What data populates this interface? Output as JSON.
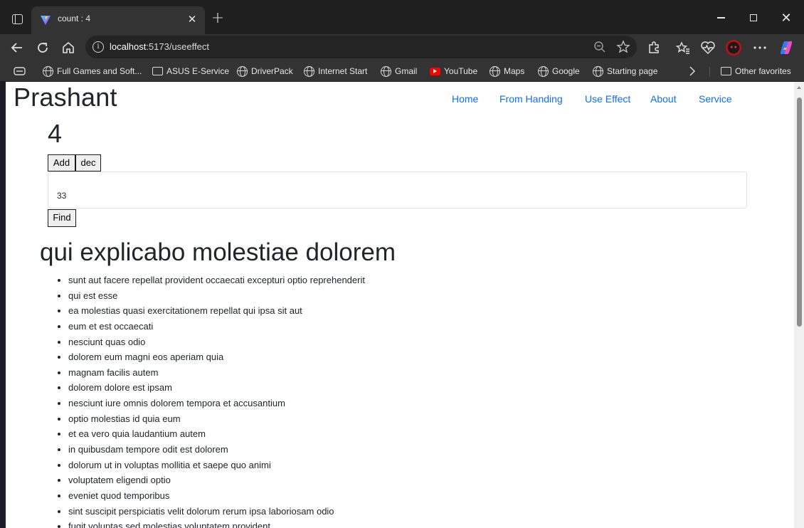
{
  "browser": {
    "tab_title": "count : 4",
    "address": {
      "host": "localhost",
      "path": ":5173/useeffect"
    },
    "bookmarks": [
      {
        "label": "Full Games and Soft...",
        "icon": "globe-icon"
      },
      {
        "label": "ASUS E-Service",
        "icon": "folder-icon"
      },
      {
        "label": "DriverPack",
        "icon": "globe-icon"
      },
      {
        "label": "Internet Start",
        "icon": "globe-icon"
      },
      {
        "label": "Gmail",
        "icon": "globe-icon"
      },
      {
        "label": "YouTube",
        "icon": "youtube-icon"
      },
      {
        "label": "Maps",
        "icon": "globe-icon"
      },
      {
        "label": "Google",
        "icon": "globe-icon"
      },
      {
        "label": "Starting page",
        "icon": "globe-icon"
      }
    ],
    "other_favorites": "Other favorites",
    "colors": {
      "chrome": "#333333",
      "titlebar": "#1f1f1f",
      "accent_link": "#0d6efd"
    }
  },
  "page": {
    "brand": "Prashant",
    "nav": [
      "Home",
      "From Handing",
      "Use Effect",
      "About",
      "Service"
    ],
    "count": "4",
    "add_label": "Add",
    "dec_label": "dec",
    "input_value": "33",
    "find_label": "Find",
    "post_title": "qui explicabo molestiae dolorem",
    "items": [
      "sunt aut facere repellat provident occaecati excepturi optio reprehenderit",
      "qui est esse",
      "ea molestias quasi exercitationem repellat qui ipsa sit aut",
      "eum et est occaecati",
      "nesciunt quas odio",
      "dolorem eum magni eos aperiam quia",
      "magnam facilis autem",
      "dolorem dolore est ipsam",
      "nesciunt iure omnis dolorem tempora et accusantium",
      "optio molestias id quia eum",
      "et ea vero quia laudantium autem",
      "in quibusdam tempore odit est dolorem",
      "dolorum ut in voluptas mollitia et saepe quo animi",
      "voluptatem eligendi optio",
      "eveniet quod temporibus",
      "sint suscipit perspiciatis velit dolorum rerum ipsa laboriosam odio",
      "fugit voluptas sed molestias voluptatem provident"
    ]
  }
}
